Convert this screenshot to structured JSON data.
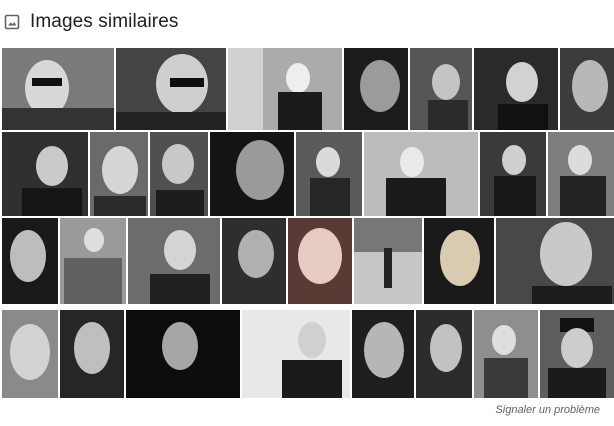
{
  "section": {
    "title": "Images similaires",
    "icon": "image-icon"
  },
  "footer": {
    "report_label": "Signaler un problème"
  },
  "thumbnails_alt": "portrait photograph",
  "colors": {
    "title": "#202124",
    "link": "#5f6368"
  }
}
